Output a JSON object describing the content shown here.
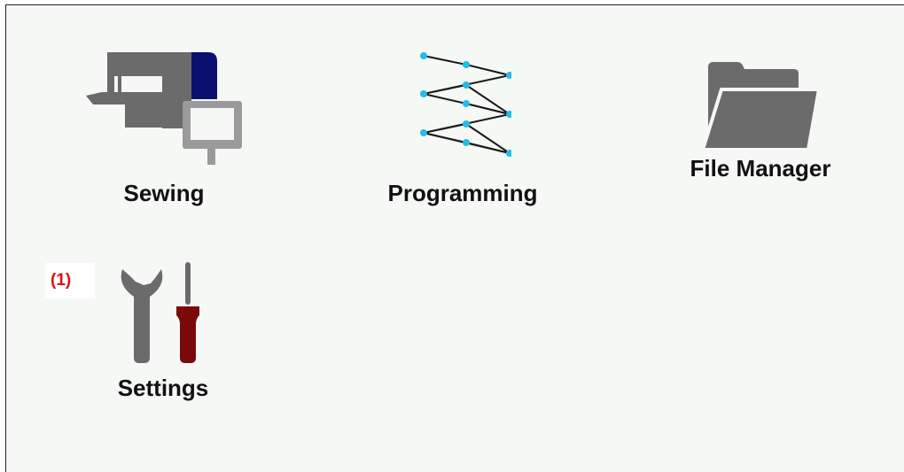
{
  "tiles": [
    {
      "label": "Sewing",
      "icon": "sewing-machine-icon"
    },
    {
      "label": "Programming",
      "icon": "zigzag-stitch-icon"
    },
    {
      "label": "File Manager",
      "icon": "folder-icon"
    },
    {
      "label": "Settings",
      "icon": "wrench-screwdriver-icon"
    }
  ],
  "callout": "(1)",
  "colors": {
    "background": "#f5f8f5",
    "icon_gray": "#6b6b6b",
    "navy": "#0a1070",
    "stitch_point": "#22bde8",
    "screwdriver_handle": "#7a0a0a",
    "callout_red": "#e01010"
  }
}
